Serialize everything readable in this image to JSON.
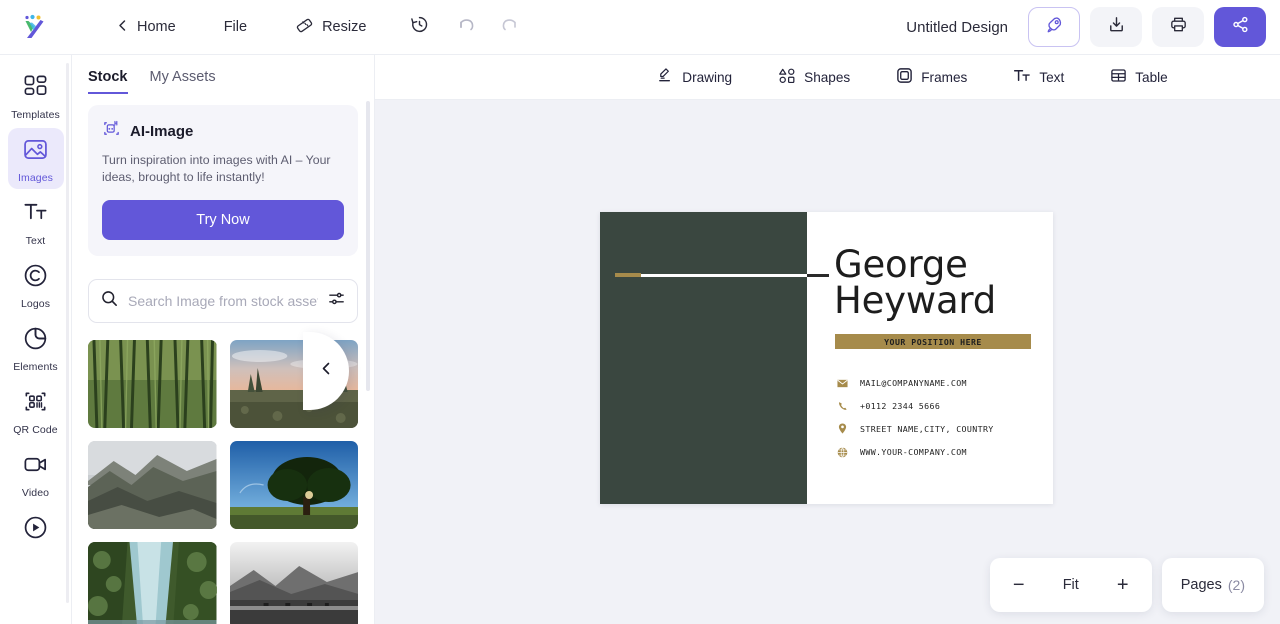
{
  "header": {
    "logo_icon": "vista-logo-icon",
    "home_label": "Home",
    "back_icon": "chevron-left-icon",
    "file_label": "File",
    "resize_label": "Resize",
    "resize_icon": "ruler-icon",
    "history_icon": "history-clock-icon",
    "undo_icon": "undo-arrow-icon",
    "redo_icon": "redo-arrow-icon",
    "doc_title": "Untitled Design",
    "publish_icon": "rocket-icon",
    "download_icon": "download-icon",
    "print_icon": "printer-icon",
    "share_icon": "share-nodes-icon"
  },
  "rail": {
    "items": [
      {
        "label": "Templates",
        "icon": "templates-grid-icon",
        "active": false
      },
      {
        "label": "Images",
        "icon": "image-photo-icon",
        "active": true
      },
      {
        "label": "Text",
        "icon": "text-tt-icon",
        "active": false
      },
      {
        "label": "Logos",
        "icon": "copyright-circle-icon",
        "active": false
      },
      {
        "label": "Elements",
        "icon": "sticker-peel-icon",
        "active": false
      },
      {
        "label": "QR Code",
        "icon": "qr-code-icon",
        "active": false
      },
      {
        "label": "Video",
        "icon": "video-camera-icon",
        "active": false
      },
      {
        "label": "",
        "icon": "audio-play-circle-icon",
        "active": false
      }
    ]
  },
  "panel": {
    "tabs": [
      {
        "label": "Stock",
        "active": true
      },
      {
        "label": "My Assets",
        "active": false
      }
    ],
    "ai_card": {
      "icon": "ai-sparkle-icon",
      "title": "AI-Image",
      "description": "Turn inspiration into images with AI – Your ideas, brought to life instantly!",
      "button_label": "Try Now"
    },
    "search": {
      "icon": "search-icon",
      "placeholder": "Search Image from stock assets",
      "value": "",
      "filter_icon": "sliders-filter-icon"
    },
    "thumbnails": [
      {
        "name": "bamboo-forest-thumbnail"
      },
      {
        "name": "moorland-sunset-thumbnail"
      },
      {
        "name": "mountain-range-thumbnail"
      },
      {
        "name": "lone-tree-blue-sky-thumbnail"
      },
      {
        "name": "waterfall-thumbnail"
      },
      {
        "name": "blackwhite-lake-thumbnail"
      }
    ],
    "collapse_icon": "chevron-left-icon"
  },
  "toolbar": {
    "items": [
      {
        "label": "Drawing",
        "icon": "pen-drawing-icon"
      },
      {
        "label": "Shapes",
        "icon": "shapes-icon"
      },
      {
        "label": "Frames",
        "icon": "frame-square-icon"
      },
      {
        "label": "Text",
        "icon": "text-tt-icon"
      },
      {
        "label": "Table",
        "icon": "table-grid-icon"
      }
    ]
  },
  "design": {
    "name": "George\nHeyward",
    "name_line1": "George",
    "name_line2": "Heyward",
    "position": "YOUR POSITION HERE",
    "contacts": [
      {
        "icon": "envelope-icon",
        "text": "MAIL@COMPANYNAME.COM"
      },
      {
        "icon": "phone-icon",
        "text": "+0112  2344 5666"
      },
      {
        "icon": "location-pin-icon",
        "text": "STREET NAME,CITY, COUNTRY"
      },
      {
        "icon": "globe-icon",
        "text": "WWW.YOUR-COMPANY.COM"
      }
    ],
    "colors": {
      "panel_green": "#3a4740",
      "accent_gold": "#a68b4b",
      "card_white": "#ffffff"
    }
  },
  "footer": {
    "zoom_out_label": "−",
    "zoom_value": "Fit",
    "zoom_in_label": "+",
    "pages_label": "Pages",
    "pages_count": "(2)"
  },
  "theme": {
    "accent_purple": "#6257d9",
    "canvas_bg": "#f1f2f7"
  }
}
